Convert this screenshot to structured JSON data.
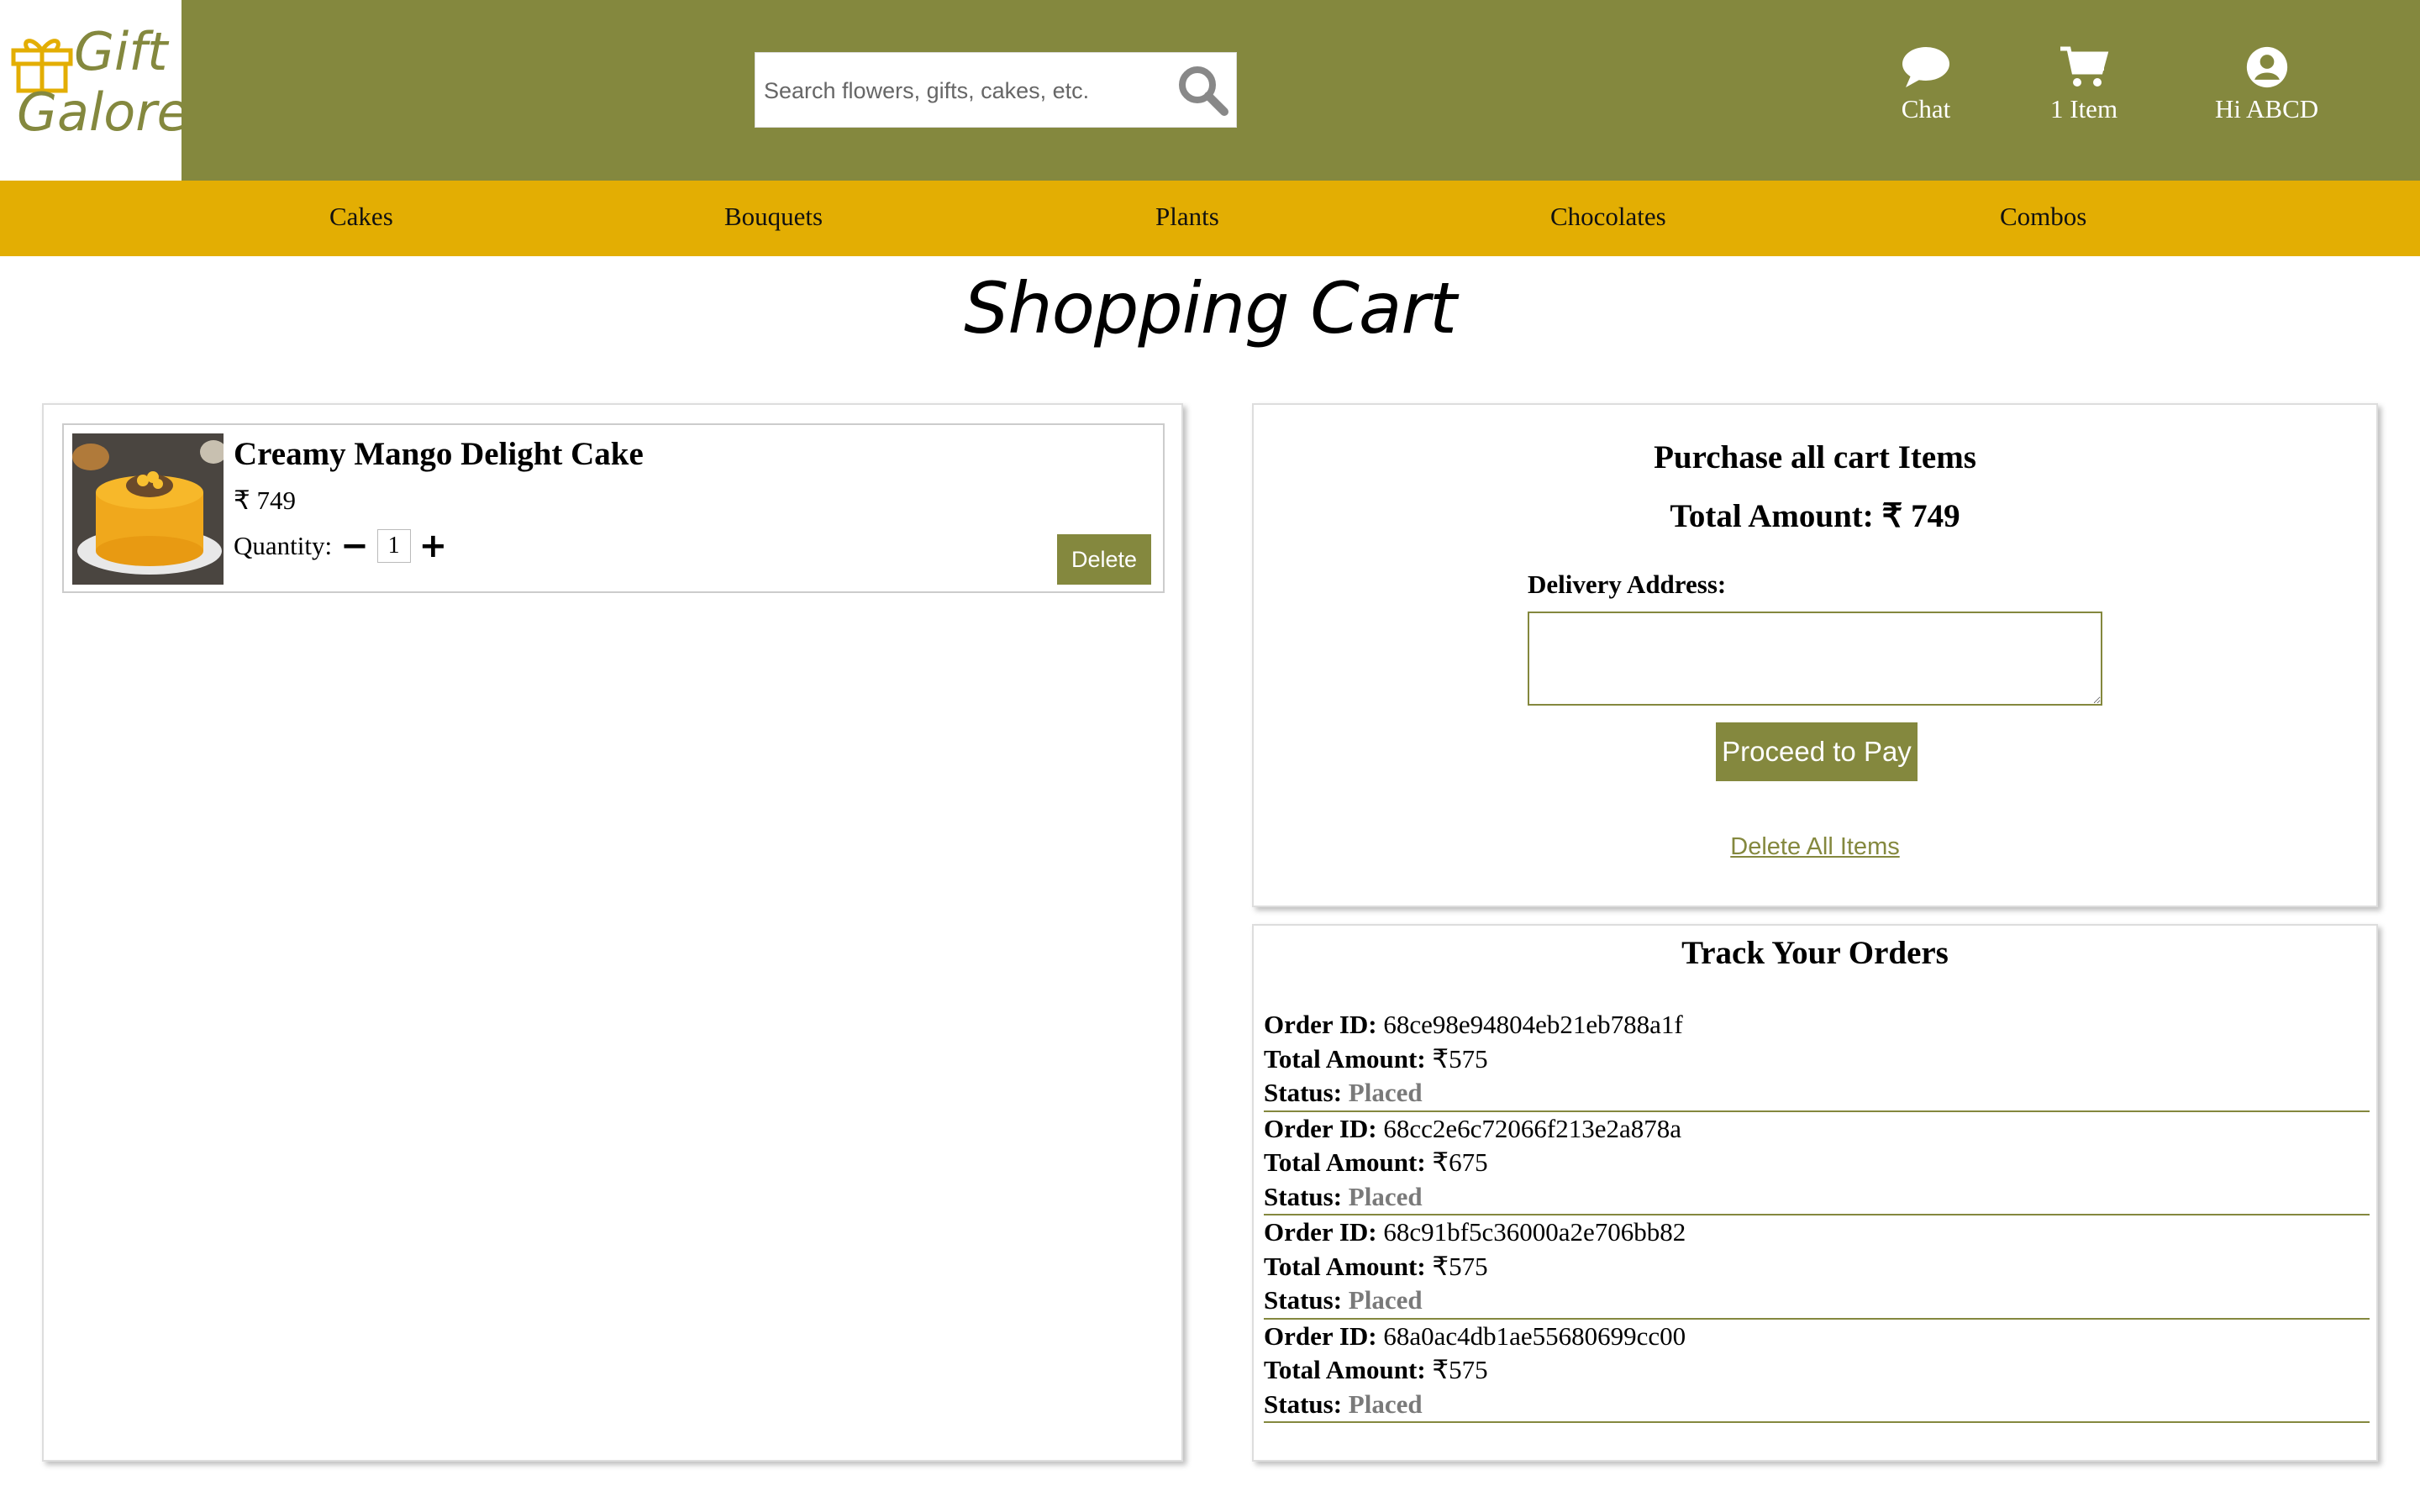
{
  "header": {
    "logo_line1": "Gift",
    "logo_line2": "Galore",
    "search_placeholder": "Search flowers, gifts, cakes, etc.",
    "chat_label": "Chat",
    "cart_label": "1 Item",
    "user_label": "Hi ABCD"
  },
  "categories": [
    "Cakes",
    "Bouquets",
    "Plants",
    "Chocolates",
    "Combos"
  ],
  "page_title": "Shopping Cart",
  "cart": {
    "items": [
      {
        "name": "Creamy Mango Delight Cake",
        "price": "₹ 749",
        "quantity_label": "Quantity:",
        "quantity": "1",
        "minus": "−",
        "plus": "+",
        "delete_label": "Delete"
      }
    ]
  },
  "purchase": {
    "title": "Purchase all cart Items",
    "total": "Total Amount: ₹ 749",
    "address_label": "Delivery Address:",
    "address_value": "",
    "pay_label": "Proceed to Pay",
    "delete_all_label": "Delete All Items"
  },
  "tracking": {
    "title": "Track Your Orders",
    "id_label": "Order ID:",
    "amount_label": "Total Amount:",
    "status_label": "Status:",
    "orders": [
      {
        "id": "68ce98e94804eb21eb788a1f",
        "amount": "₹575",
        "status": "Placed"
      },
      {
        "id": "68cc2e6c72066f213e2a878a",
        "amount": "₹675",
        "status": "Placed"
      },
      {
        "id": "68c91bf5c36000a2e706bb82",
        "amount": "₹575",
        "status": "Placed"
      },
      {
        "id": "68a0ac4db1ae55680699cc00",
        "amount": "₹575",
        "status": "Placed"
      }
    ]
  },
  "colors": {
    "header_bg": "#84883e",
    "nav_bg": "#e3ae03",
    "status_text": "#7a7a7a"
  }
}
